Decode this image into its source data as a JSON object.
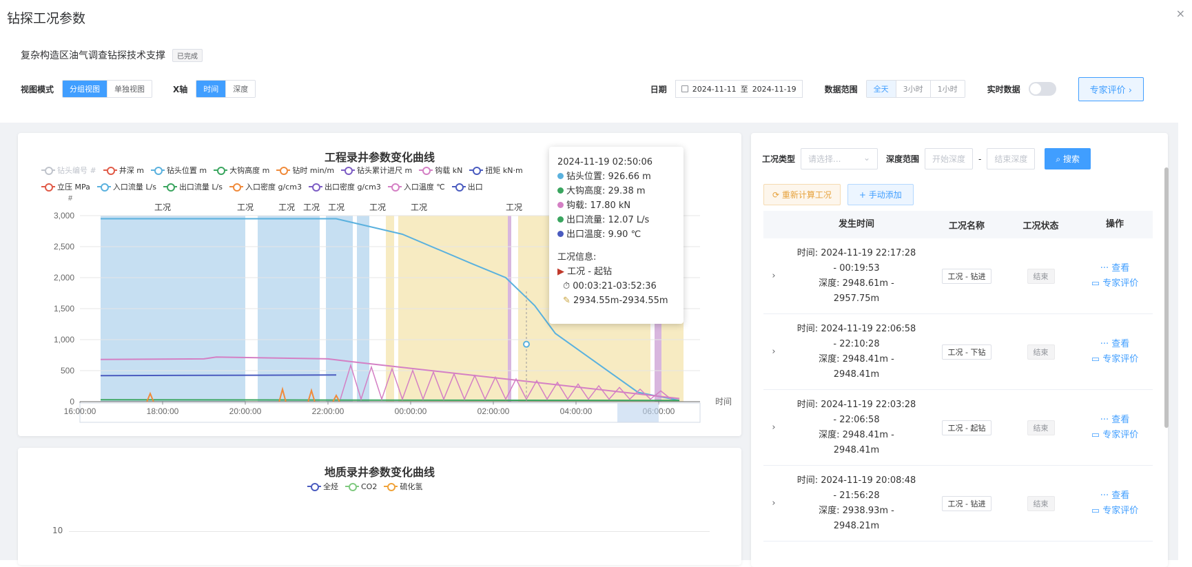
{
  "modal": {
    "title": "钻探工况参数",
    "close": "×"
  },
  "project": {
    "name": "复杂构造区油气调查钻探技术支撑",
    "status": "已完成"
  },
  "toolbar": {
    "view_mode_label": "视图模式",
    "view_modes": [
      "分组视图",
      "单独视图"
    ],
    "xaxis_label": "X轴",
    "xaxis_modes": [
      "时间",
      "深度"
    ],
    "date_label": "日期",
    "date_start": "2024-11-11",
    "date_sep": "至",
    "date_end": "2024-11-19",
    "range_label": "数据范围",
    "ranges": [
      "全天",
      "3小时",
      "1小时"
    ],
    "realtime_label": "实时数据",
    "expert_button": "专家评价 ›"
  },
  "chart1": {
    "title": "工程录井参数变化曲线",
    "legend_row1": [
      "钻头编号 #",
      "井深 m",
      "钻头位置 m",
      "大钩高度 m",
      "钻时 min/m",
      "钻头累计进尺 m",
      "钩载 kN",
      "扭矩 kN·m"
    ],
    "legend_row2": [
      "立压 MPa",
      "入口流量 L/s",
      "出口流量 L/s",
      "入口密度 g/cm3",
      "出口密度 g/cm3",
      "入口温度 ℃",
      "出口"
    ],
    "legend_colors1": [
      "#c0c4cc",
      "#e05a47",
      "#5ab1de",
      "#3aa55f",
      "#f08a3a",
      "#7c5cc4",
      "#d47fc4",
      "#4a5bbf"
    ],
    "legend_colors2": [
      "#e05a47",
      "#5ab1de",
      "#3aa55f",
      "#f08a3a",
      "#7c5cc4",
      "#d47fc4",
      "#4a5bbf"
    ],
    "y_unit": "#",
    "x_axis_name": "时间",
    "band_label": "工况"
  },
  "chart_data": {
    "type": "line",
    "title": "工程录井参数变化曲线",
    "x": [
      "16:00:00",
      "18:00:00",
      "20:00:00",
      "22:00:00",
      "00:00:00",
      "02:00:00",
      "04:00:00",
      "06:00:00"
    ],
    "ylim": [
      0,
      3000
    ],
    "yticks": [
      "0",
      "500",
      "1,000",
      "1,500",
      "2,000",
      "2,500",
      "3,000"
    ],
    "series": [
      {
        "name": "钻头位置 m",
        "color": "#5ab1de",
        "x": [
          0.5,
          6.2,
          7.8,
          9.5,
          10.3,
          11.0,
          11.5,
          13.5,
          14.5
        ],
        "values": [
          2950,
          2950,
          2700,
          2220,
          2000,
          1550,
          1100,
          150,
          20
        ]
      },
      {
        "name": "钩载 kN",
        "color": "#d47fc4",
        "x": [
          0.5,
          3.0,
          3.3,
          6.0,
          6.5,
          14.5
        ],
        "values": [
          680,
          690,
          720,
          690,
          650,
          50
        ]
      },
      {
        "name": "扭矩 kN·m",
        "color": "#4a5bbf",
        "x": [
          0.5,
          6.2
        ],
        "values": [
          420,
          430
        ]
      },
      {
        "name": "大钩高度 m",
        "color": "#3aa55f",
        "x": [
          0.5,
          14.5
        ],
        "values": [
          30,
          20
        ]
      }
    ]
  },
  "tooltip": {
    "time": "2024-11-19 02:50:06",
    "items": [
      {
        "label": "钻头位置: 926.66 m",
        "color": "#5ab1de"
      },
      {
        "label": "大钩高度: 29.38 m",
        "color": "#3aa55f"
      },
      {
        "label": "钩载: 17.80 kN",
        "color": "#d47fc4"
      },
      {
        "label": "出口流量: 12.07 L/s",
        "color": "#3aa55f"
      },
      {
        "label": "出口温度: 9.90 ℃",
        "color": "#4a5bbf"
      }
    ],
    "info_title": "工况信息:",
    "info_type": "工况 - 起钻",
    "info_time": "00:03:21-03:52:36",
    "info_depth": "2934.55m-2934.55m"
  },
  "chart2": {
    "title": "地质录井参数变化曲线",
    "legend": [
      "全烃",
      "CO2",
      "硫化氢"
    ],
    "legend_colors": [
      "#4a5bbf",
      "#7fc97f",
      "#f0a33a"
    ],
    "ytick": "10"
  },
  "right": {
    "type_label": "工况类型",
    "type_placeholder": "请选择...",
    "depth_label": "深度范围",
    "depth_start_placeholder": "开始深度",
    "depth_sep": "-",
    "depth_end_placeholder": "结束深度",
    "search_button": "搜索",
    "recalc_button": "重新计算工况",
    "manual_add_button": "手动添加",
    "columns": [
      "发生时间",
      "工况名称",
      "工况状态",
      "操作"
    ],
    "rows": [
      {
        "time1": "时间: 2024-11-19 22:17:28",
        "time2": "- 00:19:53",
        "depth1": "深度: 2948.61m -",
        "depth2": "2957.75m",
        "name": "工况 - 钻进",
        "status": "结束"
      },
      {
        "time1": "时间: 2024-11-19 22:06:58",
        "time2": "- 22:10:28",
        "depth1": "深度: 2948.41m -",
        "depth2": "2948.41m",
        "name": "工况 - 下钻",
        "status": "结束"
      },
      {
        "time1": "时间: 2024-11-19 22:03:28",
        "time2": "- 22:06:58",
        "depth1": "深度: 2948.41m -",
        "depth2": "2948.41m",
        "name": "工况 - 起钻",
        "status": "结束"
      },
      {
        "time1": "时间: 2024-11-19 20:08:48",
        "time2": "- 21:56:28",
        "depth1": "深度: 2938.93m -",
        "depth2": "2948.21m",
        "name": "工况 - 钻进",
        "status": "结束"
      }
    ],
    "op_view": "查看",
    "op_expert": "专家评价"
  }
}
